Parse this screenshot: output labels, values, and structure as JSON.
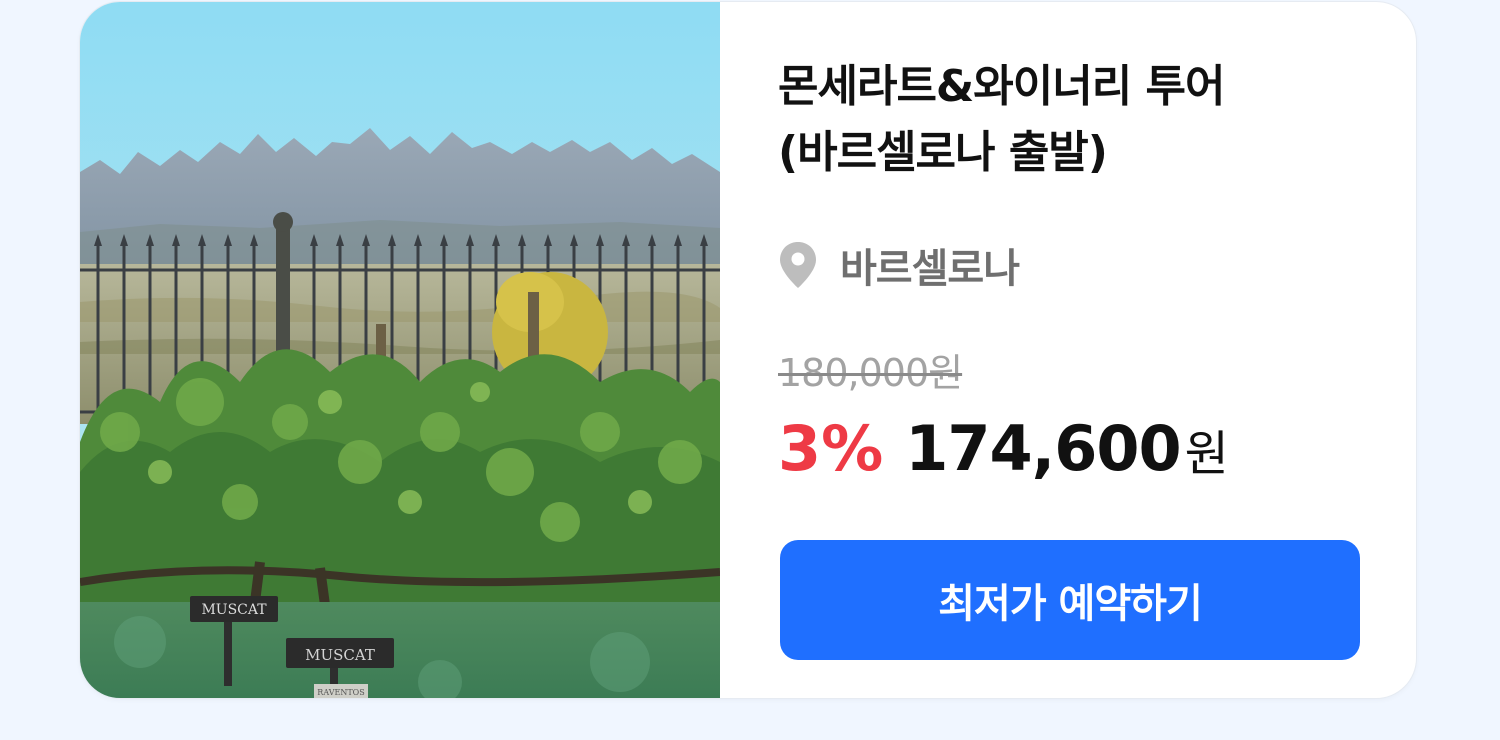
{
  "product": {
    "title_line1": "몬세라트&와이너리 투어",
    "title_line2": "(바르셀로나 출발)",
    "location": "바르셀로나",
    "location_icon": "location-pin-icon",
    "original_price": "180,000원",
    "discount": "3%",
    "price": "174,600",
    "currency": "원",
    "book_label": "최저가 예약하기",
    "image_sign_1": "MUSCAT",
    "image_sign_2": "MUSCAT",
    "image_sign_3": "RAVENTOS",
    "colors": {
      "accent": "#1f6fff",
      "discount": "#ee3a45",
      "page_background": "#f0f6ff"
    }
  }
}
